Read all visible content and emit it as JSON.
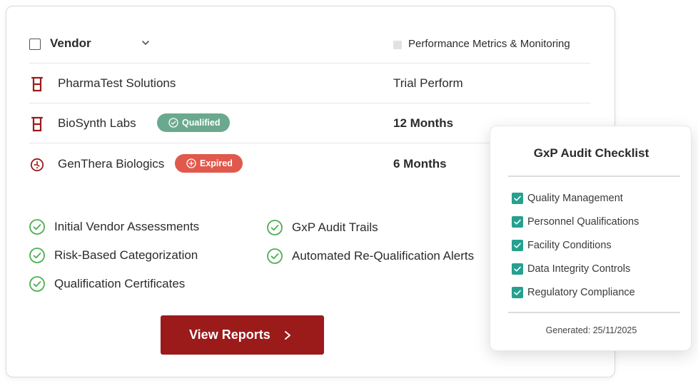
{
  "table": {
    "header": {
      "vendor_label": "Vendor",
      "metrics_label": "Performance Metrics & Monitoring"
    },
    "rows": [
      {
        "name": "PharmaTest Solutions",
        "badge": "",
        "value": "Trial Perform",
        "icon": "beaker-icon"
      },
      {
        "name": "BioSynth Labs",
        "badge": "Qualified",
        "value": "12 Months",
        "icon": "beaker-icon"
      },
      {
        "name": "GenThera Biologics",
        "badge": "Expired",
        "value": "6 Months",
        "icon": "clock-add-icon"
      }
    ]
  },
  "features": [
    "Initial Vendor Assessments",
    "Risk-Based Categorization",
    "Qualification Certificates",
    "GxP Audit Trails",
    "Automated Re-Qualification Alerts"
  ],
  "actions": {
    "view_reports_label": "View Reports"
  },
  "checklist": {
    "title": "GxP Audit Checklist",
    "items": [
      "Quality Management",
      "Personnel Qualifications",
      "Facility Conditions",
      "Data Integrity Controls",
      "Regulatory Compliance"
    ],
    "generated": "Generated: 25/11/2025"
  },
  "colors": {
    "brand_red": "#9b1b1b",
    "qualified_green": "#6aa98f",
    "expired_red": "#e0594c",
    "check_teal": "#26a08f",
    "feature_check_green": "#4caf50"
  }
}
